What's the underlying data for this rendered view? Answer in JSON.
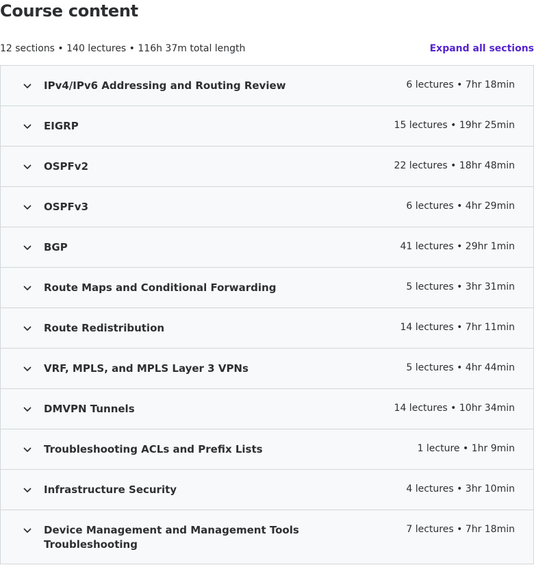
{
  "header": {
    "title": "Course content",
    "summary": "12 sections • 140 lectures • 116h 37m total length",
    "expand_label": "Expand all sections"
  },
  "sections": [
    {
      "title": "IPv4/IPv6 Addressing and Routing Review",
      "meta": "6 lectures • 7hr 18min"
    },
    {
      "title": "EIGRP",
      "meta": "15 lectures • 19hr 25min"
    },
    {
      "title": "OSPFv2",
      "meta": "22 lectures • 18hr 48min"
    },
    {
      "title": "OSPFv3",
      "meta": "6 lectures • 4hr 29min"
    },
    {
      "title": "BGP",
      "meta": "41 lectures • 29hr 1min"
    },
    {
      "title": "Route Maps and Conditional Forwarding",
      "meta": "5 lectures • 3hr 31min"
    },
    {
      "title": "Route Redistribution",
      "meta": "14 lectures • 7hr 11min"
    },
    {
      "title": "VRF, MPLS, and MPLS Layer 3 VPNs",
      "meta": "5 lectures • 4hr 44min"
    },
    {
      "title": "DMVPN Tunnels",
      "meta": "14 lectures • 10hr 34min"
    },
    {
      "title": "Troubleshooting ACLs and Prefix Lists",
      "meta": "1 lecture • 1hr 9min"
    },
    {
      "title": "Infrastructure Security",
      "meta": "4 lectures • 3hr 10min"
    },
    {
      "title": "Device Management and Management Tools Troubleshooting",
      "meta": "7 lectures • 7hr 18min"
    }
  ],
  "icons": {
    "chevron": "chevron-down-icon"
  },
  "colors": {
    "accent": "#5624d0",
    "section_bg": "#f7f9fa",
    "border": "#d1d7dc",
    "text": "#2d2f31"
  }
}
